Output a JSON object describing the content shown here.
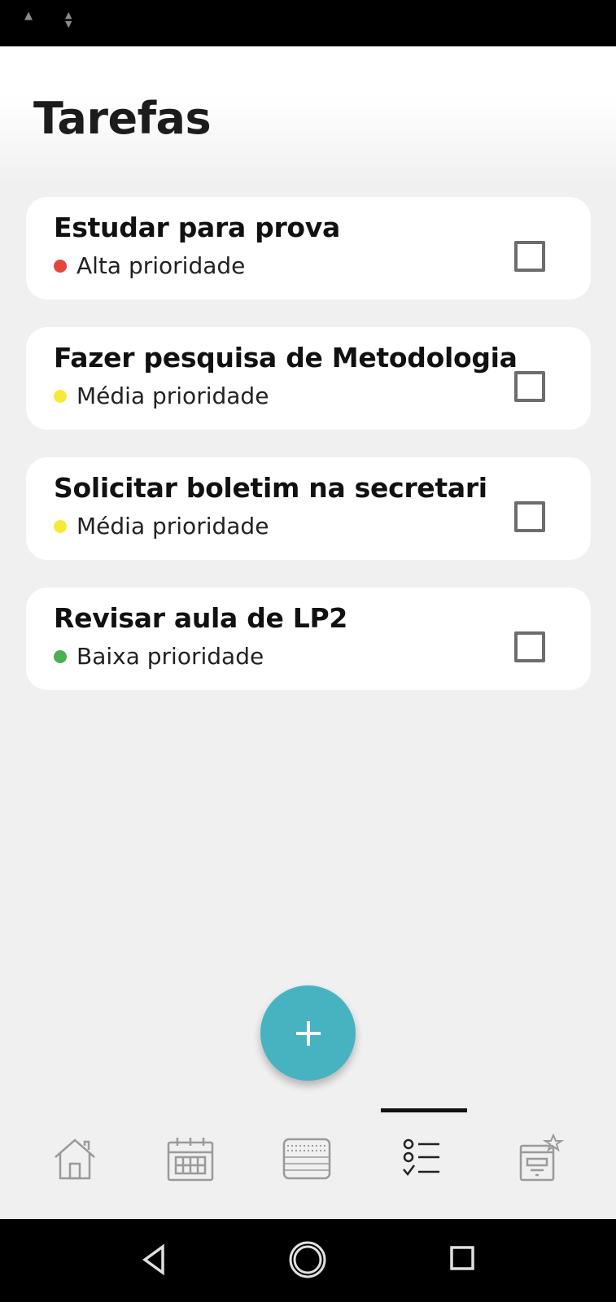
{
  "page": {
    "title": "Tarefas"
  },
  "tasks": [
    {
      "title": "Estudar para prova",
      "priority": "Alta prioridade",
      "priority_color": "#e5463c",
      "checked": false
    },
    {
      "title": "Fazer pesquisa de Metodologia",
      "priority": "Média prioridade",
      "priority_color": "#f7e938",
      "checked": false
    },
    {
      "title": "Solicitar boletim na secretari",
      "priority": "Média prioridade",
      "priority_color": "#f7e938",
      "checked": false
    },
    {
      "title": "Revisar aula de LP2",
      "priority": "Baixa prioridade",
      "priority_color": "#4caf50",
      "checked": false
    }
  ],
  "fab": {
    "icon": "plus-icon",
    "color": "#47b3c1"
  },
  "bottom_nav": {
    "items": [
      {
        "icon": "home-icon",
        "active": false
      },
      {
        "icon": "calendar-icon",
        "active": false
      },
      {
        "icon": "schedule-board-icon",
        "active": false
      },
      {
        "icon": "checklist-icon",
        "active": true
      },
      {
        "icon": "archive-star-icon",
        "active": false
      }
    ]
  },
  "system_nav": {
    "buttons": [
      "back-icon",
      "home-circle-icon",
      "recents-icon"
    ]
  }
}
